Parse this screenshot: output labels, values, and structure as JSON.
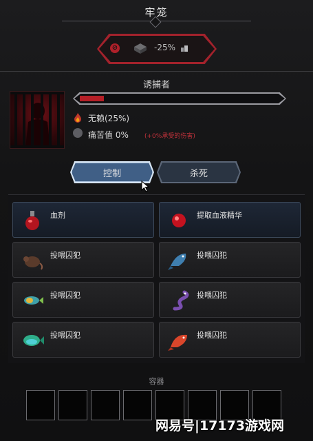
{
  "window": {
    "title": "牢笼"
  },
  "status_effect": {
    "modifier_text": "-25%"
  },
  "prisoner": {
    "name": "诱捕者",
    "bar_fill_fraction": 0.12,
    "stats": [
      {
        "icon": "fire-icon",
        "label": "无赖(25%)"
      },
      {
        "icon": "pain-icon",
        "label": "痛苦值 0%",
        "note": "(+0%承受的伤害)"
      }
    ]
  },
  "tabs": {
    "control_label": "控制",
    "kill_label": "杀死"
  },
  "actions": [
    {
      "label": "血剂",
      "icon": "blood-potion-icon"
    },
    {
      "label": "提取血液精华",
      "icon": "blood-essence-orb-icon"
    },
    {
      "label": "投喂囚犯",
      "icon": "rat-icon"
    },
    {
      "label": "投喂囚犯",
      "icon": "blue-fish-icon"
    },
    {
      "label": "投喂囚犯",
      "icon": "rainbow-fish-icon"
    },
    {
      "label": "投喂囚犯",
      "icon": "purple-eel-icon"
    },
    {
      "label": "投喂囚犯",
      "icon": "green-fish-icon"
    },
    {
      "label": "投喂囚犯",
      "icon": "red-fish-icon"
    }
  ],
  "container": {
    "title": "容器",
    "slot_count": 8
  },
  "watermark": {
    "text": "网易号|17173游戏网"
  },
  "colors": {
    "accent_red": "#b51f27",
    "control_button": "#405f86"
  }
}
